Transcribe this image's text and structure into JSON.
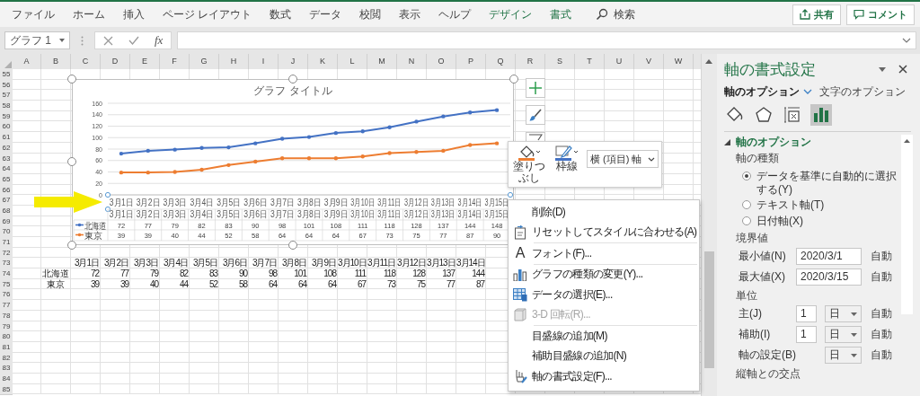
{
  "ribbon": {
    "tabs": [
      {
        "label": "ファイル",
        "kind": "normal"
      },
      {
        "label": "ホーム",
        "kind": "normal"
      },
      {
        "label": "挿入",
        "kind": "normal"
      },
      {
        "label": "ページ レイアウト",
        "kind": "normal"
      },
      {
        "label": "数式",
        "kind": "normal"
      },
      {
        "label": "データ",
        "kind": "normal"
      },
      {
        "label": "校閲",
        "kind": "normal"
      },
      {
        "label": "表示",
        "kind": "normal"
      },
      {
        "label": "ヘルプ",
        "kind": "normal"
      },
      {
        "label": "デザイン",
        "kind": "contextual"
      },
      {
        "label": "書式",
        "kind": "contextual"
      }
    ],
    "search": "検索",
    "share_button": "共有",
    "comment_button": "コメント"
  },
  "formula_bar": {
    "name_box": "グラフ 1",
    "function_label": "fx"
  },
  "sheet": {
    "columns": [
      "A",
      "B",
      "C",
      "D",
      "E",
      "F",
      "G",
      "H",
      "I",
      "J",
      "K",
      "L",
      "M",
      "N",
      "O",
      "P",
      "Q",
      "R",
      "S",
      "T",
      "U",
      "V",
      "W"
    ],
    "row_numbers": [
      "55",
      "56",
      "57",
      "58",
      "59",
      "60",
      "61",
      "62",
      "63",
      "64",
      "65",
      "66",
      "67",
      "68",
      "69",
      "70",
      "71",
      "72",
      "73",
      "74",
      "75",
      "76",
      "77",
      "78",
      "79",
      "80",
      "81",
      "82",
      "83",
      "84",
      "85"
    ],
    "table": {
      "header": [
        "3月1日",
        "3月2日",
        "3月3日",
        "3月4日",
        "3月5日",
        "3月6日",
        "3月7日",
        "3月8日",
        "3月9日",
        "3月10日",
        "3月11日",
        "3月12日",
        "3月13日",
        "3月14日"
      ],
      "rows": [
        {
          "label": "北海道",
          "values": [
            "72",
            "77",
            "79",
            "82",
            "83",
            "90",
            "98",
            "101",
            "108",
            "111",
            "118",
            "128",
            "137",
            "144"
          ]
        },
        {
          "label": "東京",
          "values": [
            "39",
            "39",
            "40",
            "44",
            "52",
            "58",
            "64",
            "64",
            "64",
            "67",
            "73",
            "75",
            "77",
            "87"
          ]
        }
      ]
    }
  },
  "chart": {
    "axis_selected": true,
    "chart_data": {
      "type": "line",
      "title": "グラフ タイトル",
      "categories": [
        "3月1日",
        "3月2日",
        "3月3日",
        "3月4日",
        "3月5日",
        "3月6日",
        "3月7日",
        "3月8日",
        "3月9日",
        "3月10日",
        "3月11日",
        "3月12日",
        "3月13日",
        "3月14日",
        "3月15日"
      ],
      "series": [
        {
          "name": "北海道",
          "color": "#4472c4",
          "values": [
            72,
            77,
            79,
            82,
            83,
            90,
            98,
            101,
            108,
            111,
            118,
            128,
            137,
            144,
            148
          ]
        },
        {
          "name": "東京",
          "color": "#ed7d31",
          "values": [
            39,
            39,
            40,
            44,
            52,
            58,
            64,
            64,
            64,
            67,
            73,
            75,
            77,
            87,
            90
          ]
        }
      ],
      "ylim": [
        0,
        160
      ],
      "yticks": [
        0,
        20,
        40,
        60,
        80,
        100,
        120,
        140,
        160
      ],
      "grid": true,
      "legend": "bottom"
    },
    "data_table": {
      "header": [
        "3月1日",
        "3月2日",
        "3月3日",
        "3月4日",
        "3月5日",
        "3月6日",
        "3月7日",
        "3月8日",
        "3月9日",
        "3月10日",
        "3月11日",
        "3月12日",
        "3月13日",
        "3月14日",
        "3月15日"
      ],
      "rows": [
        {
          "values": [
            "72",
            "77",
            "79",
            "82",
            "83",
            "90",
            "98",
            "101",
            "108",
            "111",
            "118",
            "128",
            "137",
            "144",
            "148"
          ]
        },
        {
          "values": [
            "39",
            "39",
            "40",
            "44",
            "52",
            "58",
            "64",
            "64",
            "64",
            "67",
            "73",
            "75",
            "77",
            "87",
            "90"
          ]
        }
      ]
    }
  },
  "mini_toolbar": {
    "fill_label": "塗りつぶし",
    "outline_label": "枠線",
    "element_dropdown": "横 (項目) 軸"
  },
  "context_menu": {
    "groups": [
      [
        {
          "label": "削除(D)",
          "disabled": false
        },
        {
          "label": "リセットしてスタイルに合わせる(A)",
          "disabled": false
        }
      ],
      [
        {
          "label": "フォント(F)...",
          "glyph": "A",
          "disabled": false
        }
      ],
      [
        {
          "label": "グラフの種類の変更(Y)...",
          "disabled": false
        },
        {
          "label": "データの選択(E)...",
          "disabled": false
        },
        {
          "label": "3-D 回転(R)...",
          "disabled": true
        }
      ],
      [
        {
          "label": "目盛線の追加(M)",
          "disabled": false
        },
        {
          "label": "補助目盛線の追加(N)",
          "disabled": false
        },
        {
          "label": "軸の書式設定(F)...",
          "disabled": false
        }
      ]
    ]
  },
  "format_pane": {
    "title": "軸の書式設定",
    "option_tabs": [
      {
        "label": "軸のオプション",
        "selected": true
      },
      {
        "label": "文字のオプション",
        "selected": false
      }
    ],
    "icon_tabs": [
      {
        "kind": "fill",
        "selected": false
      },
      {
        "kind": "effects",
        "selected": false
      },
      {
        "kind": "size",
        "selected": false
      },
      {
        "kind": "options",
        "selected": true
      }
    ],
    "section": {
      "title": "軸のオプション",
      "expanded": true
    },
    "axis_type": {
      "label": "軸の種類",
      "options": [
        {
          "label": "データを基準に自動的に選択する(Y)",
          "selected": true
        },
        {
          "label": "テキスト軸(T)",
          "selected": false
        },
        {
          "label": "日付軸(X)",
          "selected": false
        }
      ]
    },
    "bounds": {
      "label": "境界値",
      "rows": [
        {
          "label": "最小値(N)",
          "value": "2020/3/1",
          "status": "自動"
        },
        {
          "label": "最大値(X)",
          "value": "2020/3/15",
          "status": "自動"
        }
      ]
    },
    "units": {
      "label": "単位",
      "rows": [
        {
          "label": "主(J)",
          "number": "1",
          "unit": "日",
          "status": "自動"
        },
        {
          "label": "補助(I)",
          "number": "1",
          "unit": "日",
          "status": "自動"
        },
        {
          "label": "軸の設定(B)",
          "unit": "日",
          "status": "自動"
        }
      ]
    },
    "next_section": "縦軸との交点"
  }
}
